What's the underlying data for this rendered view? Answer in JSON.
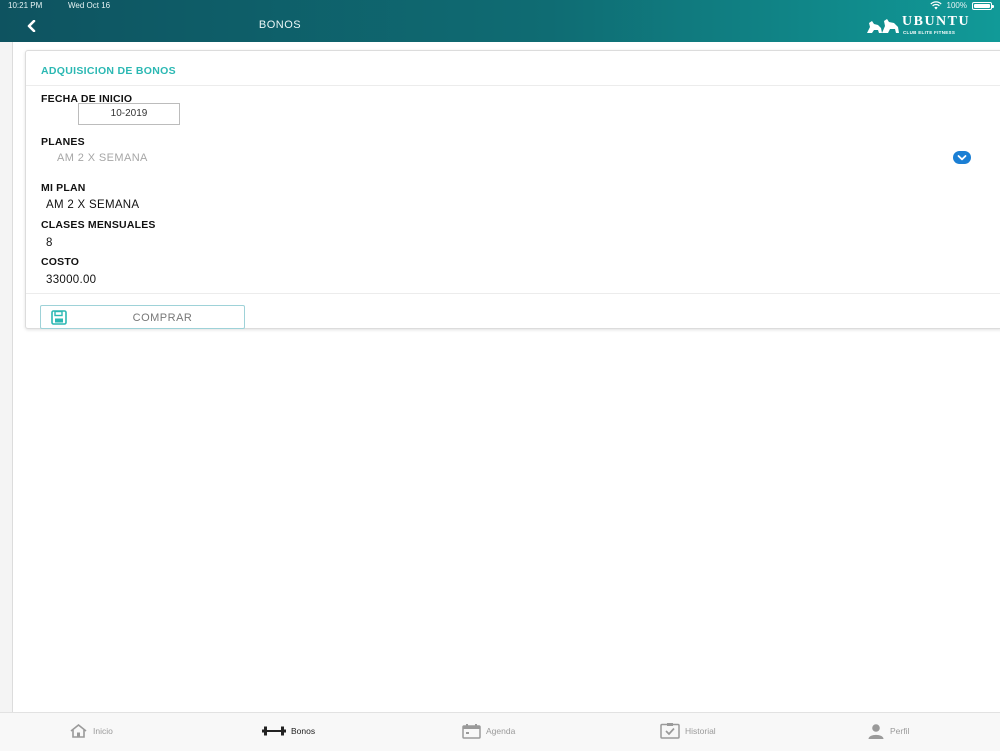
{
  "status_bar": {
    "time": "10:21 PM",
    "date": "Wed Oct 16",
    "battery": "100%"
  },
  "header": {
    "title": "BONOS",
    "brand_name": "UBUNTU",
    "brand_tagline": "CLUB ELITE FITNESS",
    "gradient_start": "#0e5360",
    "gradient_end": "#119a98"
  },
  "card": {
    "title": "ADQUISICION DE BONOS",
    "fecha_inicio": {
      "label": "FECHA DE INICIO",
      "value": "10-2019"
    },
    "planes": {
      "label": "PLANES",
      "selected": "AM 2 X SEMANA",
      "icon": "chevron-down-icon"
    },
    "mi_plan": {
      "label": "MI PLAN",
      "value": "AM 2 X SEMANA"
    },
    "clases_mensuales": {
      "label": "CLASES MENSUALES",
      "value": "8"
    },
    "costo": {
      "label": "COSTO",
      "value": "33000.00"
    },
    "buy_button": {
      "label": "COMPRAR",
      "icon": "save-icon"
    }
  },
  "tabs": [
    {
      "label": "Inicio",
      "icon": "home-icon",
      "active": false
    },
    {
      "label": "Bonos",
      "icon": "dumbbell-icon",
      "active": true
    },
    {
      "label": "Agenda",
      "icon": "calendar-icon",
      "active": false
    },
    {
      "label": "Historial",
      "icon": "clipboard-check-icon",
      "active": false
    },
    {
      "label": "Perfil",
      "icon": "user-icon",
      "active": false
    }
  ],
  "colors": {
    "accent": "#2bb8b3",
    "select_icon": "#1b7fd4"
  }
}
